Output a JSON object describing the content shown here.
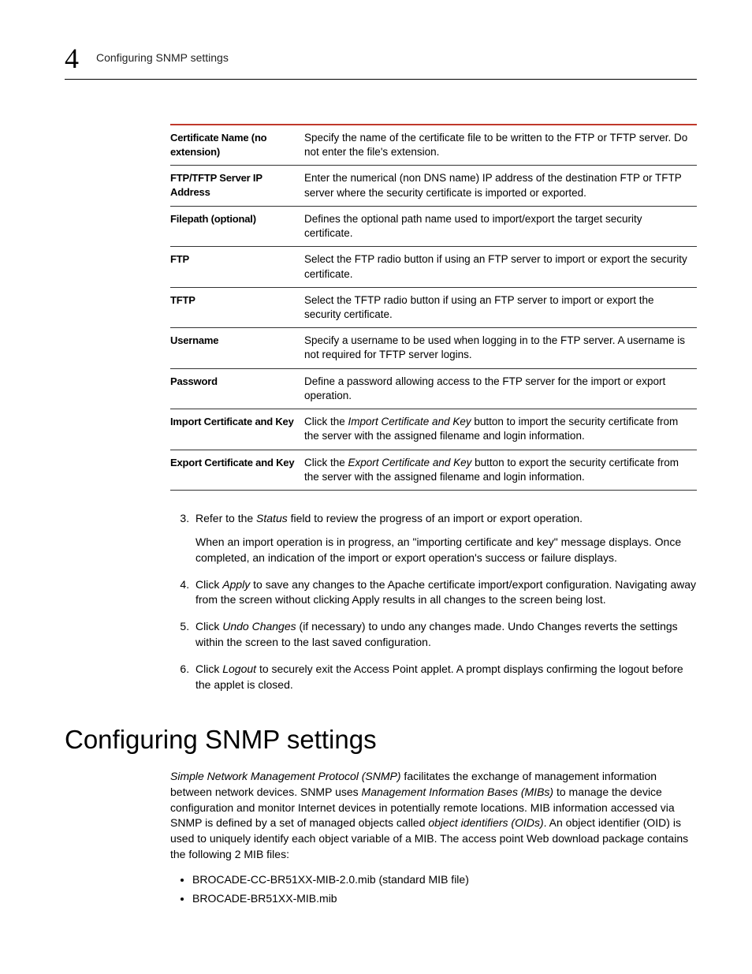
{
  "header": {
    "chapter_number": "4",
    "running_title": "Configuring SNMP settings"
  },
  "table": {
    "rows": [
      {
        "key": "Certificate Name (no extension)",
        "val": "Specify the name of the certificate file to be written to the FTP or TFTP server. Do not enter the file's extension."
      },
      {
        "key": "FTP/TFTP Server IP Address",
        "val": "Enter the numerical (non DNS name) IP address of the destination FTP or TFTP server where the security certificate is imported or exported."
      },
      {
        "key": "Filepath (optional)",
        "val": "Defines the optional path name used to import/export the target security certificate."
      },
      {
        "key": "FTP",
        "val": "Select the FTP radio button if using an FTP server to import or export the security certificate."
      },
      {
        "key": "TFTP",
        "val": "Select the TFTP radio button if using an FTP server to import or export the security certificate."
      },
      {
        "key": "Username",
        "val": "Specify a username to be used when logging in to the FTP server. A username is not required for TFTP server logins."
      },
      {
        "key": "Password",
        "val": "Define a password allowing access to the FTP server for the import or export operation."
      },
      {
        "key": "Import Certificate and Key",
        "val_pre": "Click the ",
        "val_em": "Import Certificate and Key",
        "val_post": " button to import the security certificate from the server with the assigned filename and login information."
      },
      {
        "key": "Export Certificate and Key",
        "val_pre": "Click the ",
        "val_em": "Export Certificate and Key",
        "val_post": " button to export the security certificate from the server with the assigned filename and login information."
      }
    ]
  },
  "steps": {
    "start": 3,
    "s3_a": "Refer to the ",
    "s3_em": "Status",
    "s3_b": " field to review the progress of an import or export operation.",
    "s3_p": "When an import operation is in progress, an \"importing certificate and key\" message displays. Once completed, an indication of the import or export operation's success or failure displays.",
    "s4_a": "Click ",
    "s4_em": "Apply",
    "s4_b": " to save any changes to the Apache certificate import/export configuration. Navigating away from the screen without clicking Apply results in all changes to the screen being lost.",
    "s5_a": "Click ",
    "s5_em": "Undo Changes",
    "s5_b": " (if necessary) to undo any changes made. Undo Changes reverts the settings within the screen to the last saved configuration.",
    "s6_a": "Click ",
    "s6_em": "Logout",
    "s6_b": " to securely exit the Access Point applet. A prompt displays confirming the logout before the applet is closed."
  },
  "section": {
    "title": "Configuring SNMP settings",
    "p_em1": "Simple Network Management Protocol (SNMP)",
    "p_a": " facilitates the exchange of management information between network devices. SNMP uses ",
    "p_em2": "Management Information Bases (MIBs)",
    "p_b": " to manage the device configuration and monitor Internet devices in potentially remote locations. MIB information accessed via SNMP is defined by a set of managed objects called ",
    "p_em3": "object identifiers (OIDs)",
    "p_c": ". An object identifier (OID) is used to uniquely identify each object variable of a MIB. The access point Web download package contains the following 2 MIB files:",
    "bullets": [
      "BROCADE-CC-BR51XX-MIB-2.0.mib (standard MIB file)",
      "BROCADE-BR51XX-MIB.mib"
    ]
  }
}
